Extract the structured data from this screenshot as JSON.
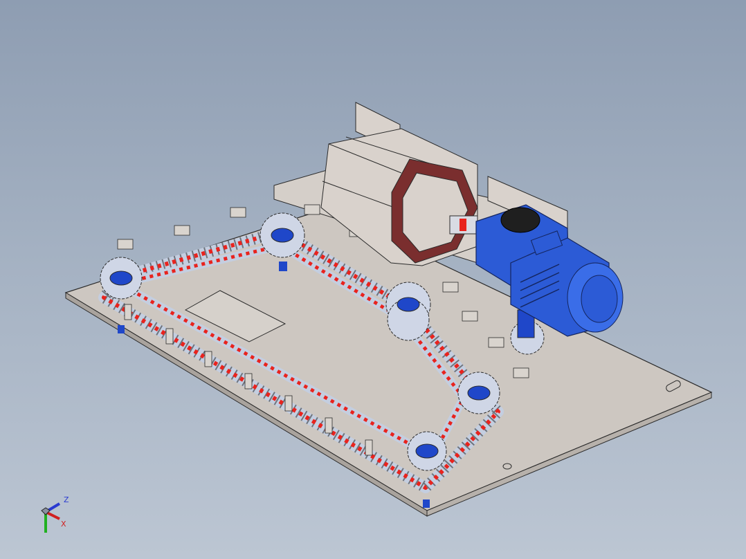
{
  "viewport": {
    "background_top": "#8e9db2",
    "background_bottom": "#bcc6d3"
  },
  "model": {
    "base_plate_color": "#cdc7c1",
    "edge_color": "#2a2a2a",
    "chain_link_color": "#c4cee0",
    "chain_roller_color": "#e8231e",
    "sprocket_color": "#cfd6e6",
    "hub_color": "#1f47c9",
    "motor_color": "#2c5bd6",
    "drum_color": "#d9d2cc",
    "drum_interior_color": "#7a2e2e"
  },
  "triad": {
    "z_label": "Z",
    "x_label": "X",
    "z_color": "#2a3ad0",
    "x_color": "#d02020",
    "y_color": "#20b020"
  }
}
